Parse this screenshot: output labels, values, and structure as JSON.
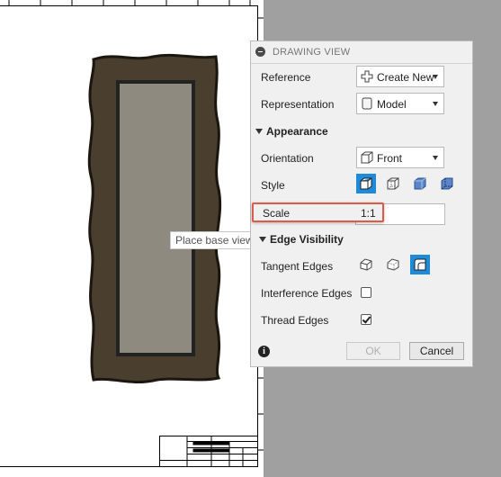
{
  "tooltip": {
    "text": "Place base view"
  },
  "panel": {
    "title": "DRAWING VIEW",
    "reference": {
      "label": "Reference",
      "value": "Create New",
      "icon": "plus-icon"
    },
    "representation": {
      "label": "Representation",
      "value": "Model",
      "icon": "model-icon"
    },
    "appearance": {
      "section_label": "Appearance",
      "orientation": {
        "label": "Orientation",
        "value": "Front",
        "icon": "cube-icon"
      },
      "style": {
        "label": "Style",
        "options": [
          "visible-edges-icon",
          "hidden-edges-icon",
          "shaded-icon",
          "shaded-hidden-edges-icon"
        ],
        "selected": "visible-edges-icon"
      },
      "scale": {
        "label": "Scale",
        "value": "1:1"
      }
    },
    "edge_visibility": {
      "section_label": "Edge Visibility",
      "tangent_edges": {
        "label": "Tangent Edges",
        "options": [
          "tangent-off-icon",
          "tangent-phantom-icon",
          "tangent-full-icon"
        ],
        "selected": "tangent-full-icon"
      },
      "interference_edges": {
        "label": "Interference Edges",
        "checked": false
      },
      "thread_edges": {
        "label": "Thread Edges",
        "checked": true
      }
    },
    "ok_label": "OK",
    "cancel_label": "Cancel",
    "info_icon": "i"
  },
  "colors": {
    "frame_dark": "#4a3f2e",
    "frame_inner": "#8f8a80",
    "accent_blue": "#1f8ad8",
    "highlight_red": "#e05a4a"
  }
}
